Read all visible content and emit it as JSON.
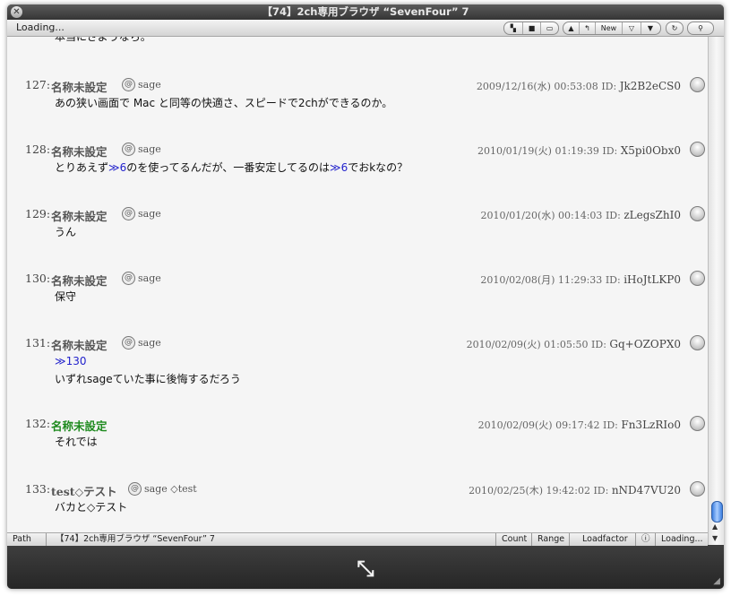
{
  "window": {
    "title": "【74】2ch専用ブラウザ “SevenFour” 7"
  },
  "toolbar": {
    "loading": "Loading...",
    "new_label": "New"
  },
  "top_cut_text": "本当にさようなら。",
  "posts": [
    {
      "num": "127:",
      "name": "名称未設定",
      "mail": "sage",
      "date": "2009/12/16(水) 00:53:08",
      "id_label": "ID:",
      "id": "Jk2B2eCS0",
      "body": "あの狭い画面で Mac と同等の快適さ、スピードで2chができるのか。"
    },
    {
      "num": "128:",
      "name": "名称未設定",
      "mail": "sage",
      "date": "2010/01/19(火) 01:19:39",
      "id_label": "ID:",
      "id": "X5pi0Obx0",
      "body_parts": [
        "とりあえず",
        "≫6",
        "のを使ってるんだが、一番安定してるのは",
        "≫6",
        "でおkなの？"
      ]
    },
    {
      "num": "129:",
      "name": "名称未設定",
      "mail": "sage",
      "date": "2010/01/20(水) 00:14:03",
      "id_label": "ID:",
      "id": "zLegsZhI0",
      "body": "うん"
    },
    {
      "num": "130:",
      "name": "名称未設定",
      "mail": "sage",
      "date": "2010/02/08(月) 11:29:33",
      "id_label": "ID:",
      "id": "iHoJtLKP0",
      "body": "保守"
    },
    {
      "num": "131:",
      "name": "名称未設定",
      "mail": "sage",
      "date": "2010/02/09(火) 01:05:50",
      "id_label": "ID:",
      "id": "Gq+OZOPX0",
      "anchor": "≫130",
      "body": "いずれsageていた事に後悔するだろう"
    },
    {
      "num": "132:",
      "name": "名称未設定",
      "mail": "",
      "date": "2010/02/09(火) 09:17:42",
      "id_label": "ID:",
      "id": "Fn3LzRIo0",
      "body": "それでは"
    },
    {
      "num": "133:",
      "name": "test◇テスト",
      "mail": "sage ◇test",
      "date": "2010/02/25(木) 19:42:02",
      "id_label": "ID:",
      "id": "nND47VU20",
      "body": "バカと◇テスト"
    }
  ],
  "statusbar": {
    "path": "Path",
    "thread": "【74】2ch専用ブラウザ “SevenFour” 7",
    "count": "Count",
    "range": "Range",
    "loadfactor": "Loadfactor",
    "loading": "Loading..."
  },
  "colors": {
    "anchor": "#2222cc",
    "green_name": "#1e8a1e",
    "content_bg": "#f5f5f5",
    "scroll_thumb": "#3c7fe0"
  },
  "icons": {
    "close": "close-icon",
    "mail": "at-mail-icon",
    "pin": "id-pin-icon",
    "resize": "expand-arrows-icon"
  }
}
